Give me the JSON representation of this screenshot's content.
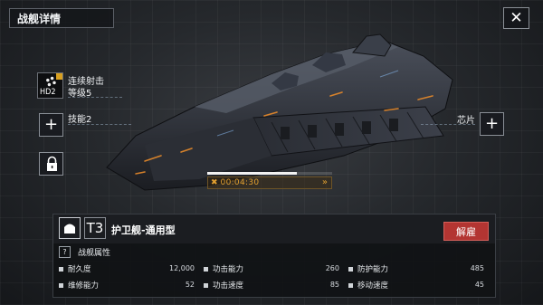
{
  "header": {
    "title": "战舰详情",
    "close_icon": "close-icon"
  },
  "skill": {
    "code": "HD2",
    "name": "连续射击",
    "level": "等级5"
  },
  "slots": {
    "skill2_label": "技能2",
    "chip_label": "芯片",
    "plus_symbol": "+"
  },
  "timer": {
    "value": "00:04:30",
    "progress": 0.72,
    "accent": "#e2a030"
  },
  "ship": {
    "tier": "T3",
    "name": "护卫舰-通用型",
    "dismiss_label": "解雇"
  },
  "attributes": {
    "help_symbol": "?",
    "title": "战舰属性",
    "stats": [
      {
        "label": "耐久度",
        "value": "12,000"
      },
      {
        "label": "功击能力",
        "value": "260"
      },
      {
        "label": "防护能力",
        "value": "485"
      },
      {
        "label": "维修能力",
        "value": "52"
      },
      {
        "label": "功击速度",
        "value": "85"
      },
      {
        "label": "移动速度",
        "value": "45"
      }
    ]
  },
  "colors": {
    "dismiss": "#b33532",
    "panel": "#101215",
    "accent": "#e2a030"
  }
}
